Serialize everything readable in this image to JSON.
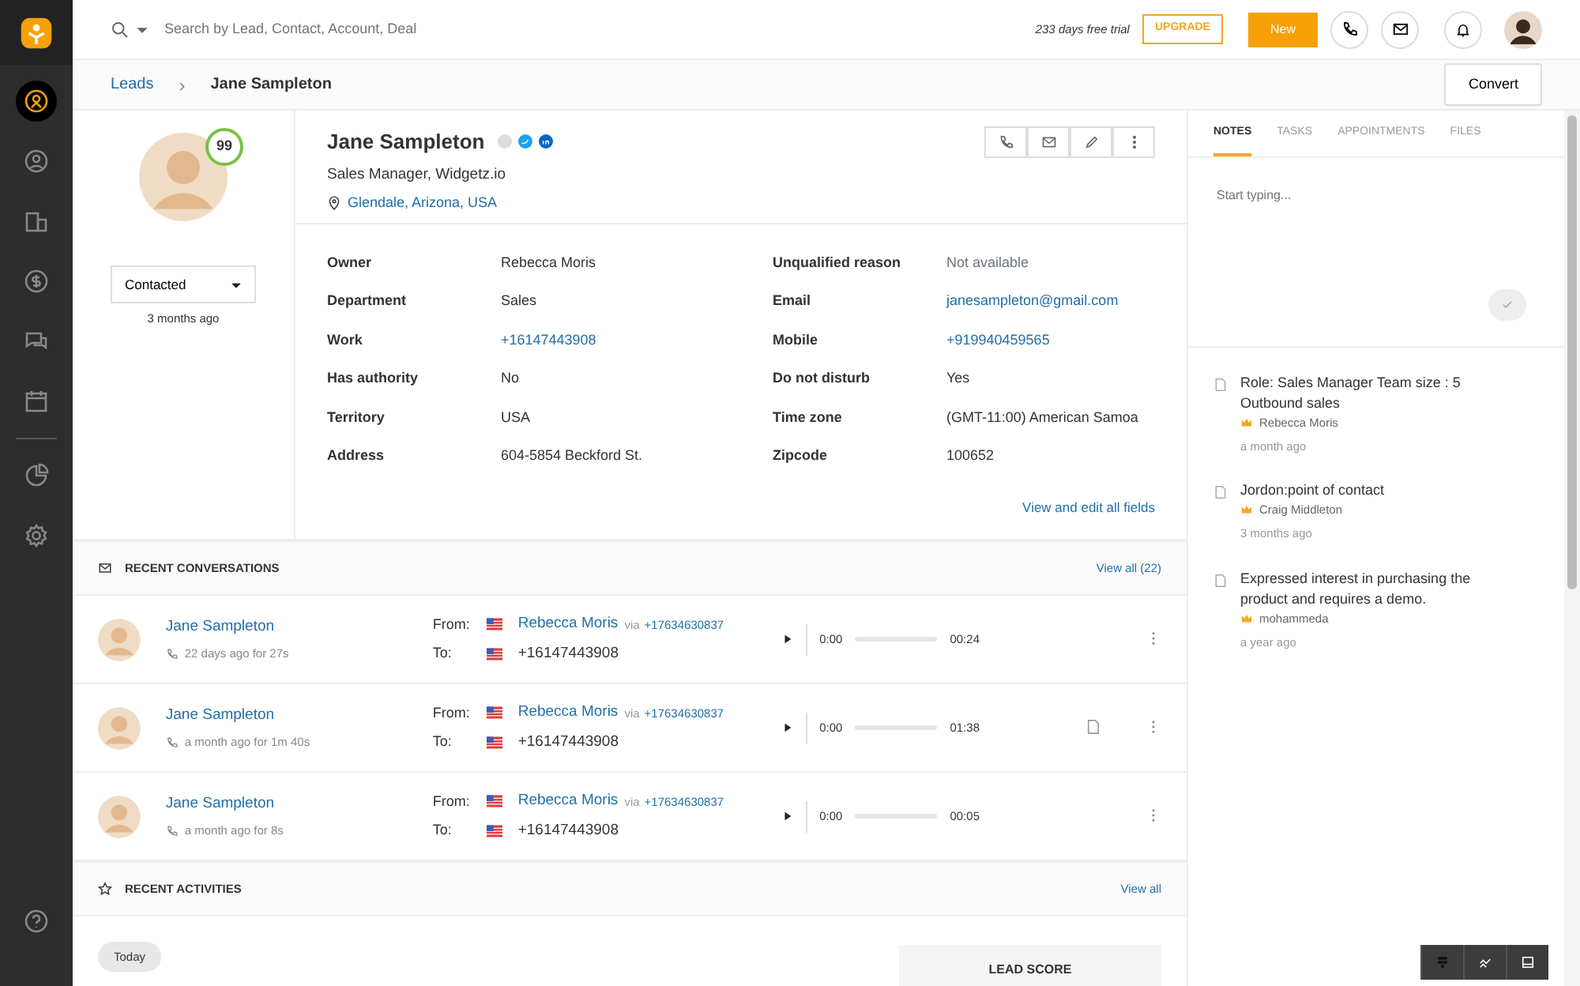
{
  "sidebar": {
    "items": [
      {
        "selected": true
      },
      {
        "selected": false
      },
      {
        "selected": false
      },
      {
        "selected": false
      },
      {
        "selected": false
      },
      {
        "selected": false
      },
      {
        "selected": false
      },
      {
        "selected": false
      }
    ]
  },
  "topbar": {
    "search_placeholder": "Search by Lead, Contact, Account, Deal",
    "trial": "233 days free trial",
    "upgrade": "UPGRADE",
    "new": "New"
  },
  "breadcrumb": {
    "parent": "Leads",
    "separator": "›",
    "current": "Jane Sampleton",
    "action": "Convert"
  },
  "profile": {
    "score": "99",
    "status": "Contacted",
    "status_time": "3 months ago",
    "name": "Jane Sampleton",
    "title": "Sales Manager, Widgetz.io",
    "location": "Glendale, Arizona, USA"
  },
  "fields": [
    {
      "label": "Owner",
      "value": "Rebecca Moris",
      "kind": "text"
    },
    {
      "label": "Unqualified reason",
      "value": "Not available",
      "kind": "muted"
    },
    {
      "label": "Department",
      "value": "Sales",
      "kind": "text"
    },
    {
      "label": "Email",
      "value": "janesampleton@gmail.com",
      "kind": "link"
    },
    {
      "label": "Work",
      "value": "+16147443908",
      "kind": "link"
    },
    {
      "label": "Mobile",
      "value": "+919940459565",
      "kind": "link"
    },
    {
      "label": "Has authority",
      "value": "No",
      "kind": "text"
    },
    {
      "label": "Do not disturb",
      "value": "Yes",
      "kind": "text"
    },
    {
      "label": "Territory",
      "value": "USA",
      "kind": "text"
    },
    {
      "label": "Time zone",
      "value": "(GMT-11:00) American Samoa",
      "kind": "text"
    },
    {
      "label": "Address",
      "value": "604-5854 Beckford St.",
      "kind": "text"
    },
    {
      "label": "Zipcode",
      "value": "100652",
      "kind": "text"
    }
  ],
  "view_all_fields": "View and edit all fields",
  "conversations": {
    "title": "RECENT CONVERSATIONS",
    "view_all": "View all (22)",
    "rows": [
      {
        "name": "Jane Sampleton",
        "meta": "22 days ago for 27s",
        "from_label": "From:",
        "from": "Rebecca Moris",
        "via": "via",
        "via_number": "+17634630837",
        "to_label": "To:",
        "to": "+16147443908",
        "start": "0:00",
        "end": "00:24",
        "level": 0,
        "note": false
      },
      {
        "name": "Jane Sampleton",
        "meta": "a month ago for 1m 40s",
        "from_label": "From:",
        "from": "Rebecca Moris",
        "via": "via",
        "via_number": "+17634630837",
        "to_label": "To:",
        "to": "+16147443908",
        "start": "0:00",
        "end": "01:38",
        "level": 0,
        "note": true
      },
      {
        "name": "Jane Sampleton",
        "meta": "a month ago for 8s",
        "from_label": "From:",
        "from": "Rebecca Moris",
        "via": "via",
        "via_number": "+17634630837",
        "to_label": "To:",
        "to": "+16147443908",
        "start": "0:00",
        "end": "00:05",
        "level": 0,
        "note": false
      }
    ]
  },
  "activities": {
    "title": "RECENT ACTIVITIES",
    "view_all": "View all",
    "day": "Today",
    "lead_score": "LEAD SCORE"
  },
  "tabs": [
    {
      "label": "NOTES",
      "selected": true
    },
    {
      "label": "TASKS",
      "selected": false
    },
    {
      "label": "APPOINTMENTS",
      "selected": false
    },
    {
      "label": "FILES",
      "selected": false
    }
  ],
  "notes": {
    "placeholder": "Start typing...",
    "items": [
      {
        "text": "Role: Sales Manager Team size : 5 Outbound sales",
        "author": "Rebecca Moris",
        "time": "a month ago"
      },
      {
        "text": "Jordon:point of contact",
        "author": "Craig Middleton",
        "time": "3 months ago"
      },
      {
        "text": "Expressed interest in purchasing the product and requires a demo.",
        "author": "mohammeda",
        "time": "a year ago"
      }
    ]
  }
}
